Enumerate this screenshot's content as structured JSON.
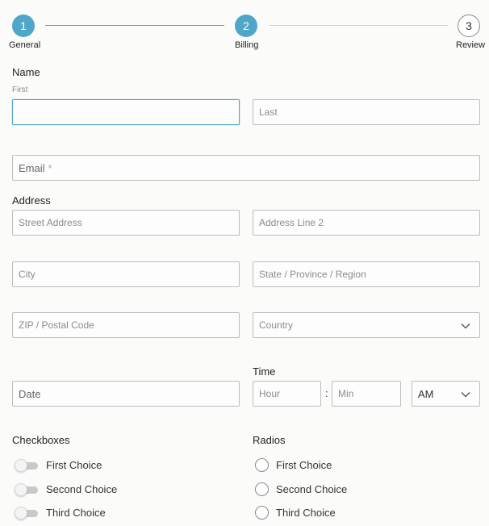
{
  "stepper": {
    "steps": [
      {
        "number": "1",
        "label": "General",
        "state": "active"
      },
      {
        "number": "2",
        "label": "Billing",
        "state": "active"
      },
      {
        "number": "3",
        "label": "Review",
        "state": "todo"
      }
    ],
    "accent_color": "#4fa6c9"
  },
  "name": {
    "label": "Name",
    "first_sublabel": "First",
    "first_value": "",
    "last_placeholder": "Last"
  },
  "email": {
    "placeholder": "Email",
    "required_marker": "*"
  },
  "address": {
    "label": "Address",
    "street_placeholder": "Street Address",
    "line2_placeholder": "Address Line 2",
    "city_placeholder": "City",
    "state_placeholder": "State / Province / Region",
    "zip_placeholder": "ZIP / Postal Code",
    "country_placeholder": "Country"
  },
  "date": {
    "placeholder": "Date"
  },
  "time": {
    "label": "Time",
    "hour_placeholder": "Hour",
    "separator": ":",
    "min_placeholder": "Min",
    "ampm_value": "AM"
  },
  "checkboxes": {
    "label": "Checkboxes",
    "options": [
      "First Choice",
      "Second Choice",
      "Third Choice"
    ]
  },
  "radios": {
    "label": "Radios",
    "options": [
      "First Choice",
      "Second Choice",
      "Third Choice"
    ]
  },
  "icons": {
    "select_arrow": "chevron-down-icon"
  }
}
